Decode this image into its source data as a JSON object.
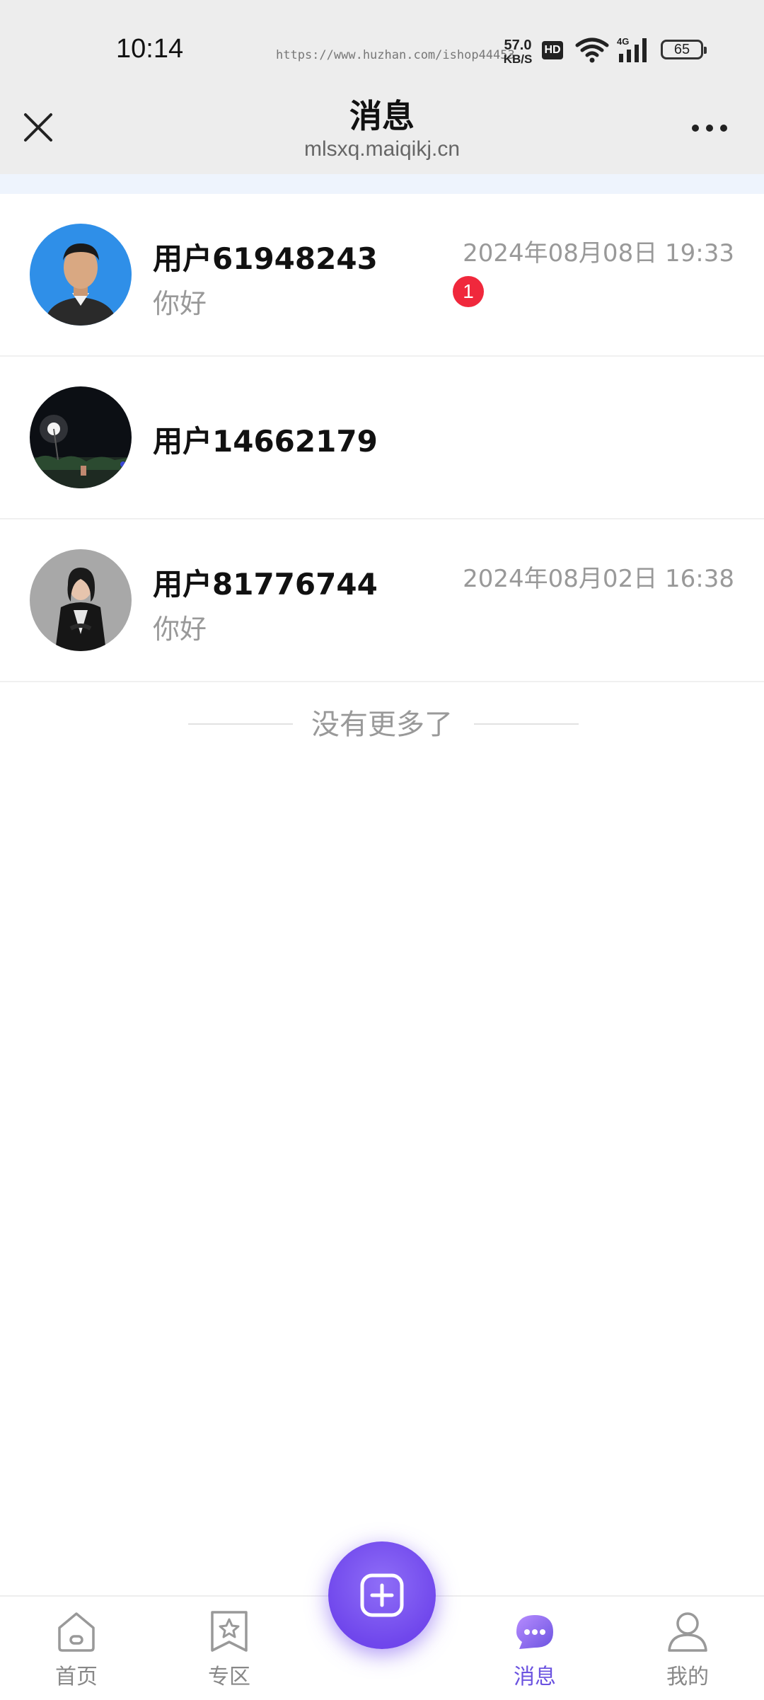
{
  "status_bar": {
    "time": "10:14",
    "url_watermark": "https://www.huzhan.com/ishop44453",
    "net_speed": "57.0",
    "net_speed_unit": "KB/S",
    "hd_label": "HD",
    "network_type": "4G",
    "battery": "65"
  },
  "header": {
    "title": "消息",
    "subtitle": "mlsxq.maiqikj.cn",
    "close_icon": "close-icon",
    "more_icon": "more-dots-icon"
  },
  "messages": [
    {
      "name": "用户61948243",
      "time": "2024年08月08日 19:33",
      "preview": "你好",
      "unread": "1"
    },
    {
      "name": "用户14662179",
      "time": "",
      "preview": "",
      "unread": ""
    },
    {
      "name": "用户81776744",
      "time": "2024年08月02日 16:38",
      "preview": "你好",
      "unread": ""
    }
  ],
  "list_end_text": "没有更多了",
  "tabbar": {
    "items": [
      {
        "label": "首页",
        "icon": "home-icon"
      },
      {
        "label": "专区",
        "icon": "star-icon"
      },
      {
        "label": "消息",
        "icon": "chat-icon",
        "active": true
      },
      {
        "label": "我的",
        "icon": "user-icon"
      }
    ],
    "fab_icon": "add-icon"
  },
  "colors": {
    "accent": "#7047ec",
    "unread_badge": "#f0283c",
    "header_bg": "#ededed"
  }
}
